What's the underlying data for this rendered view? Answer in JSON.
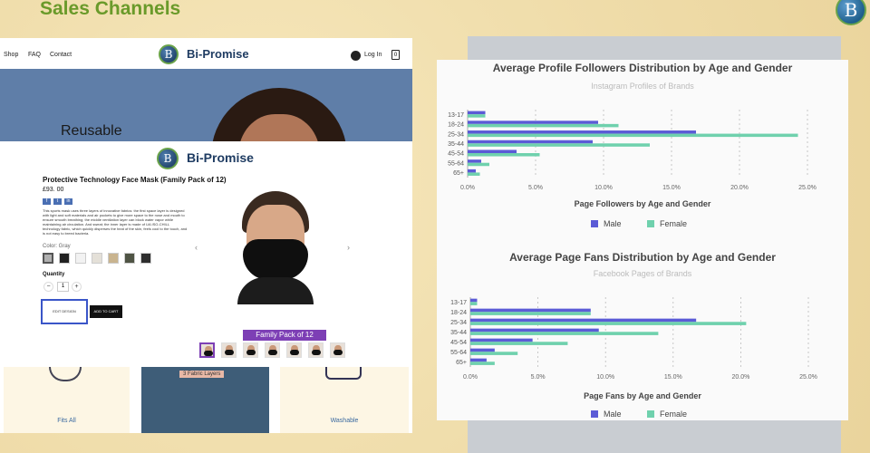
{
  "slide": {
    "title": "Sales Channels"
  },
  "corner_logo": {
    "glyph": "B"
  },
  "website": {
    "nav": [
      "Shop",
      "FAQ",
      "Contact"
    ],
    "brand": "Bi-Promise",
    "login": "Log In",
    "cart_count": "0",
    "hero_text": "Reusable",
    "product": {
      "title": "Protective Technology Face Mask (Family Pack of 12)",
      "price": "£93. 00",
      "share_icons": [
        "f",
        "t",
        "in"
      ],
      "description": "This sports mask uses three layers of innovative fabrics: the first space layer is designed with light and soft materials and air pockets to give more space to the nose and mouth to ensure smooth breathing; the middle ventilation layer can block water vapor while maintaining air circulation. And sweat; the inner layer is made of UA ISO-CHILL technology fabric, which quickly disperses the heat of the skin, feels cool to the touch, and is not easy to breed bacteria.",
      "color_label": "Color: Gray",
      "swatches": [
        "#b0b0b0",
        "#222222",
        "#f2f2f2",
        "#e4e0d8",
        "#c9b48f",
        "#4f5444",
        "#2e2e2e"
      ],
      "quantity_label": "Quantity",
      "quantity_minus": "−",
      "quantity_value": "1",
      "quantity_plus": "+",
      "edit_design": "EDIT DESIGN",
      "add_to_cart": "ADD TO CART",
      "pack_banner": "Family Pack of 12",
      "prev_arrow": "‹",
      "next_arrow": "›"
    },
    "features": [
      {
        "label": "Fits All"
      },
      {
        "label": "3 Fabric Layers"
      },
      {
        "label": "Washable"
      }
    ]
  },
  "chart_data": [
    {
      "type": "bar",
      "title": "Average Profile Followers Distribution by Age and Gender",
      "subtitle": "Instagram Profiles of Brands",
      "categories": [
        "13-17",
        "18-24",
        "25-34",
        "35-44",
        "45-54",
        "55-64",
        "65+"
      ],
      "series": [
        {
          "name": "Male",
          "color": "#5b5bd6",
          "values": [
            1.3,
            9.6,
            16.8,
            9.2,
            3.6,
            1.0,
            0.6
          ]
        },
        {
          "name": "Female",
          "color": "#6fd1ad",
          "values": [
            1.3,
            11.1,
            24.3,
            13.4,
            5.3,
            1.6,
            0.9
          ]
        }
      ],
      "xlabel": "Page Followers by Age and Gender",
      "ylabel": "",
      "xlim": [
        0,
        25
      ],
      "xticks": [
        "0.0%",
        "5.0%",
        "10.0%",
        "15.0%",
        "20.0%",
        "25.0%"
      ],
      "legend": "bottom",
      "grid": true
    },
    {
      "type": "bar",
      "title": "Average Page Fans Distribution by Age and Gender",
      "subtitle": "Facebook Pages of Brands",
      "categories": [
        "13-17",
        "18-24",
        "25-34",
        "35-44",
        "45-54",
        "55-64",
        "65+"
      ],
      "series": [
        {
          "name": "Male",
          "color": "#5b5bd6",
          "values": [
            0.5,
            8.9,
            16.7,
            9.5,
            4.6,
            1.8,
            1.2
          ]
        },
        {
          "name": "Female",
          "color": "#6fd1ad",
          "values": [
            0.5,
            8.9,
            20.4,
            13.9,
            7.2,
            3.5,
            1.8
          ]
        }
      ],
      "xlabel": "Page Fans by Age and Gender",
      "ylabel": "",
      "xlim": [
        0,
        25
      ],
      "xticks": [
        "0.0%",
        "5.0%",
        "10.0%",
        "15.0%",
        "20.0%",
        "25.0%"
      ],
      "legend": "bottom",
      "grid": true
    }
  ]
}
